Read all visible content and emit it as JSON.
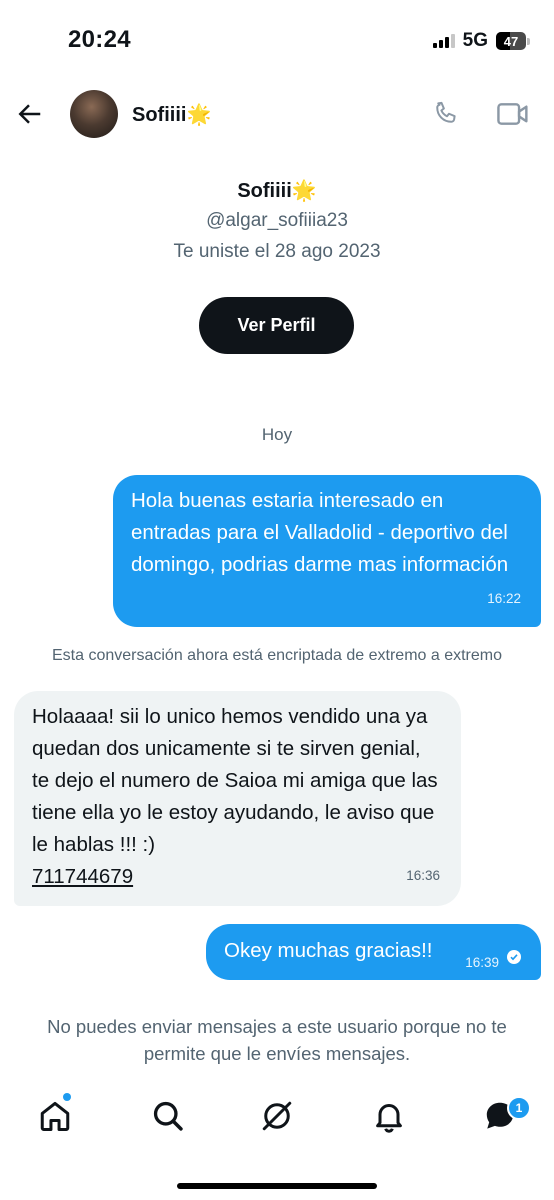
{
  "status_bar": {
    "time": "20:24",
    "network": "5G",
    "battery": "47",
    "battery_level": 0.47
  },
  "header": {
    "contact_name": "Sofiiii🌟"
  },
  "profile": {
    "name": "Sofiiii🌟",
    "handle": "@algar_sofiiia23",
    "joined": "Te uniste el 28 ago 2023",
    "view_profile_label": "Ver Perfil"
  },
  "conversation": {
    "day_label": "Hoy",
    "messages": [
      {
        "direction": "out",
        "text": "Hola buenas estaria interesado en entradas para el Valladolid - deportivo del domingo, podrias darme mas información",
        "time": "16:22"
      },
      {
        "direction": "in",
        "text": "Holaaaa! sii lo unico hemos vendido una ya  quedan dos unicamente si te sirven genial, te dejo el numero de Saioa mi amiga que las tiene ella yo le estoy ayudando, le aviso que le hablas !!! :)",
        "phone": "711744679",
        "time": "16:36"
      },
      {
        "direction": "out",
        "text": "Okey muchas gracias!!",
        "time": "16:39"
      }
    ],
    "encryption_notice": "Esta conversación ahora está encriptada de extremo a extremo",
    "blocked_notice": "No puedes enviar mensajes a este usuario porque no te permite que le envíes mensajes."
  },
  "tab_bar": {
    "messages_badge": "1"
  },
  "colors": {
    "accent": "#1d9bf0",
    "incoming_bubble": "#eff3f4",
    "text_primary": "#0f1419",
    "text_secondary": "#536471"
  },
  "icons": [
    "back-arrow-icon",
    "phone-icon",
    "video-icon",
    "home-icon",
    "search-icon",
    "grok-icon",
    "bell-icon",
    "messages-icon"
  ]
}
